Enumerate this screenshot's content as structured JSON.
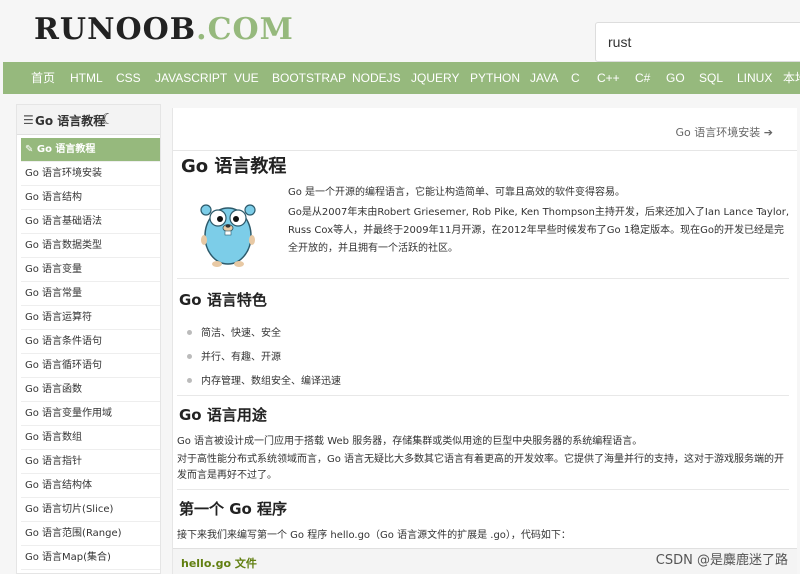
{
  "header": {
    "logo_part1": "RUNOOB",
    "logo_part2": ".COM",
    "search_value": "rust"
  },
  "nav": {
    "items": [
      "首页",
      "HTML",
      "CSS",
      "JAVASCRIPT",
      "VUE",
      "BOOTSTRAP",
      "NODEJS",
      "JQUERY",
      "PYTHON",
      "JAVA",
      "C",
      "C++",
      "C#",
      "GO",
      "SQL",
      "LINUX",
      "本地"
    ]
  },
  "sidebar": {
    "title": "Go 语言教程",
    "items": [
      "Go 语言教程",
      "Go 语言环境安装",
      "Go 语言结构",
      "Go 语言基础语法",
      "Go 语言数据类型",
      "Go 语言变量",
      "Go 语言常量",
      "Go 语言运算符",
      "Go 语言条件语句",
      "Go 语言循环语句",
      "Go 语言函数",
      "Go 语言变量作用域",
      "Go 语言数组",
      "Go 语言指针",
      "Go 语言结构体",
      "Go 语言切片(Slice)",
      "Go 语言范围(Range)",
      "Go 语言Map(集合)"
    ]
  },
  "content": {
    "prev_link": "Go 语言环境安装",
    "title": "Go 语言教程",
    "intro_1": "Go 是一个开源的编程语言，它能让构造简单、可靠且高效的软件变得容易。",
    "intro_2": "Go是从2007年末由Robert Griesemer, Rob Pike, Ken Thompson主持开发，后来还加入了Ian Lance Taylor, Russ Cox等人，并最终于2009年11月开源，在2012年早些时候发布了Go 1稳定版本。现在Go的开发已经是完全开放的，并且拥有一个活跃的社区。",
    "features_title": "Go 语言特色",
    "features": [
      "简洁、快速、安全",
      "并行、有趣、开源",
      "内存管理、数组安全、编译迅速"
    ],
    "usage_title": "Go 语言用途",
    "usage_1": "Go 语言被设计成一门应用于搭载 Web 服务器，存储集群或类似用途的巨型中央服务器的系统编程语言。",
    "usage_2": "对于高性能分布式系统领域而言，Go 语言无疑比大多数其它语言有着更高的开发效率。它提供了海量并行的支持，这对于游戏服务端的开发而言是再好不过了。",
    "first_title": "第一个 Go 程序",
    "first_para": "接下来我们来编写第一个 Go 程序 hello.go（Go 语言源文件的扩展是 .go），代码如下：",
    "code_file": "hello.go 文件"
  },
  "watermark": "CSDN @是麋鹿迷了路"
}
